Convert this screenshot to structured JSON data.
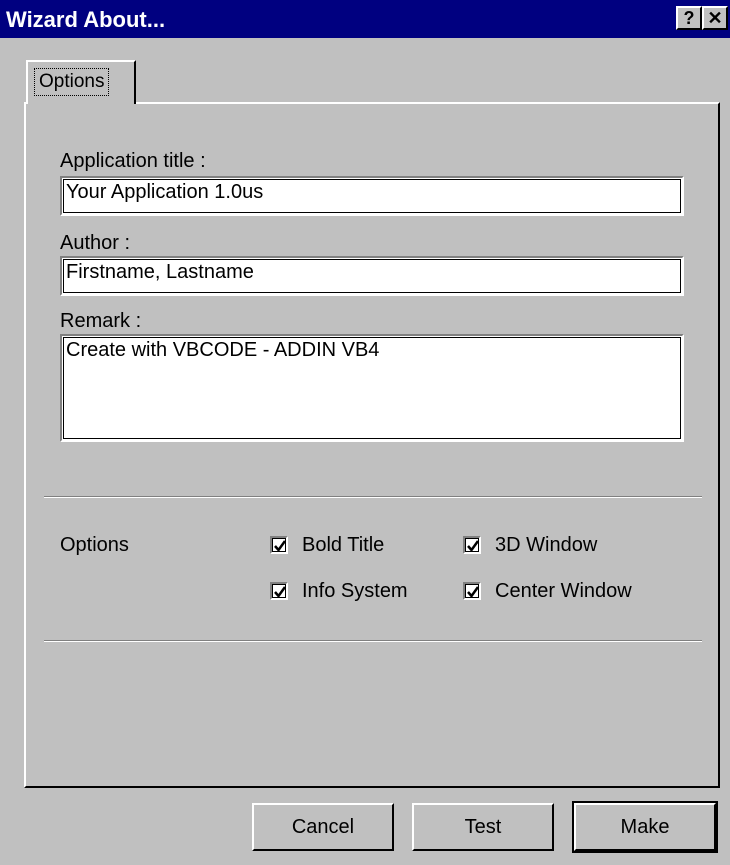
{
  "window": {
    "title": "Wizard About...",
    "help_glyph": "?",
    "close_glyph": "✕"
  },
  "tab": {
    "label": "Options"
  },
  "form": {
    "app_title_label": "Application title :",
    "app_title_value": "Your Application 1.0us",
    "author_label": "Author :",
    "author_value": "Firstname, Lastname",
    "remark_label": "Remark :",
    "remark_value": "Create with VBCODE - ADDIN VB4"
  },
  "options": {
    "section_label": "Options",
    "items": [
      {
        "label": "Bold Title",
        "checked": true
      },
      {
        "label": "3D Window",
        "checked": true
      },
      {
        "label": "Info System",
        "checked": true
      },
      {
        "label": "Center Window",
        "checked": true
      }
    ]
  },
  "buttons": {
    "cancel": "Cancel",
    "test": "Test",
    "make": "Make"
  }
}
